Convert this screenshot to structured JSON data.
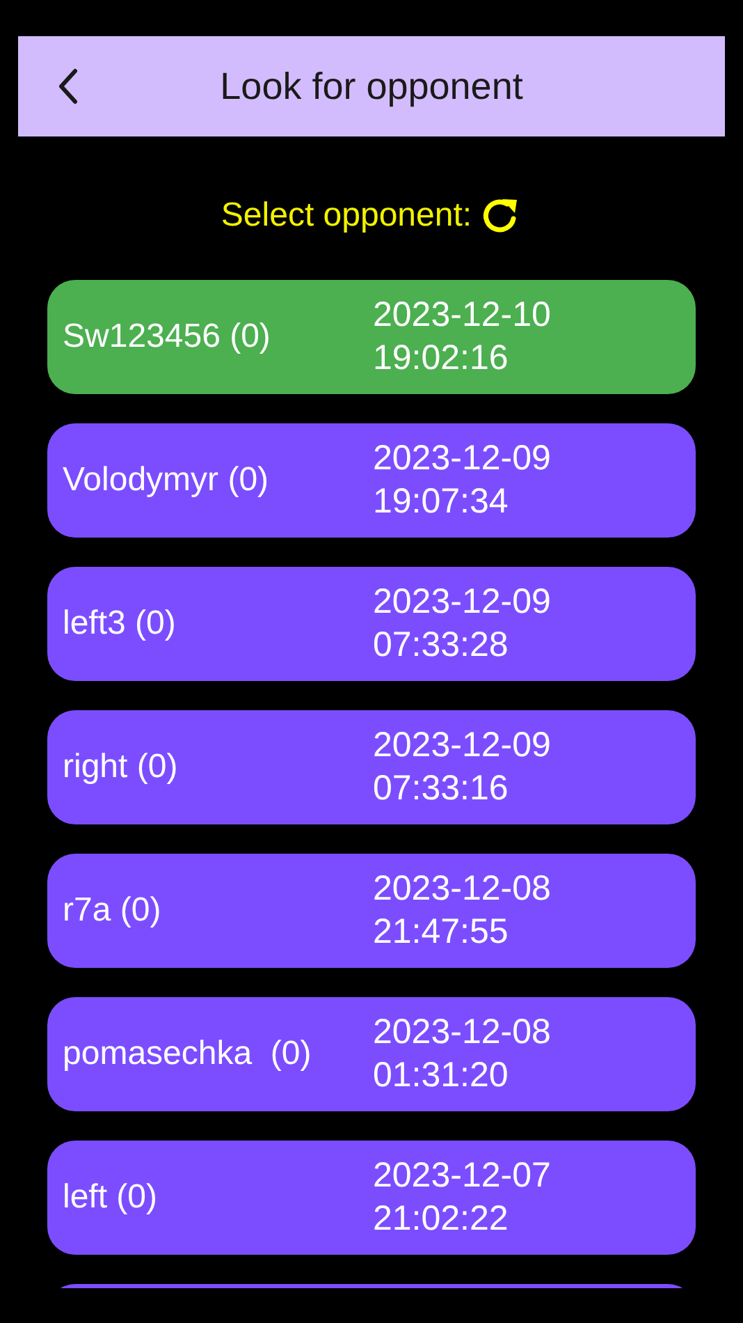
{
  "header": {
    "title": "Look for opponent"
  },
  "prompt": {
    "label": "Select opponent:"
  },
  "opponents": [
    {
      "name": "Sw123456 (0)",
      "date": "2023-12-10",
      "time": "19:02:16",
      "selected": true
    },
    {
      "name": "Volodymyr (0)",
      "date": "2023-12-09",
      "time": "19:07:34",
      "selected": false
    },
    {
      "name": "left3 (0)",
      "date": "2023-12-09",
      "time": "07:33:28",
      "selected": false
    },
    {
      "name": "right (0)",
      "date": "2023-12-09",
      "time": "07:33:16",
      "selected": false
    },
    {
      "name": "r7a (0)",
      "date": "2023-12-08",
      "time": "21:47:55",
      "selected": false
    },
    {
      "name": "pomasechka  (0)",
      "date": "2023-12-08",
      "time": "01:31:20",
      "selected": false
    },
    {
      "name": "left (0)",
      "date": "2023-12-07",
      "time": "21:02:22",
      "selected": false
    }
  ]
}
